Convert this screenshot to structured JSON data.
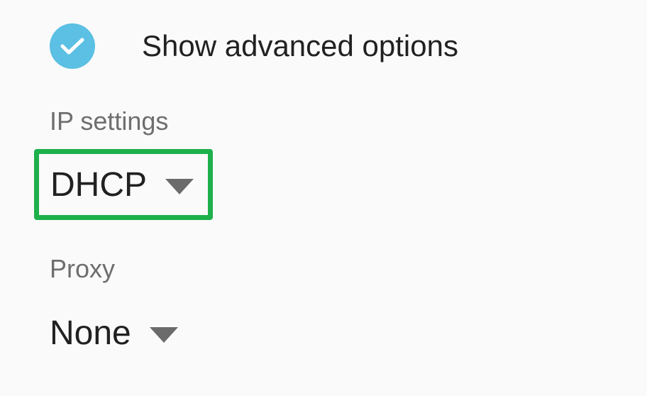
{
  "advanced": {
    "label": "Show advanced options",
    "checked": true,
    "check_color": "#5bc0e3",
    "icon": "checkmark-icon"
  },
  "ip_settings": {
    "label": "IP settings",
    "value": "DHCP",
    "icon": "dropdown-arrow-icon",
    "highlight_color": "#1db04b"
  },
  "proxy": {
    "label": "Proxy",
    "value": "None",
    "icon": "dropdown-arrow-icon"
  }
}
